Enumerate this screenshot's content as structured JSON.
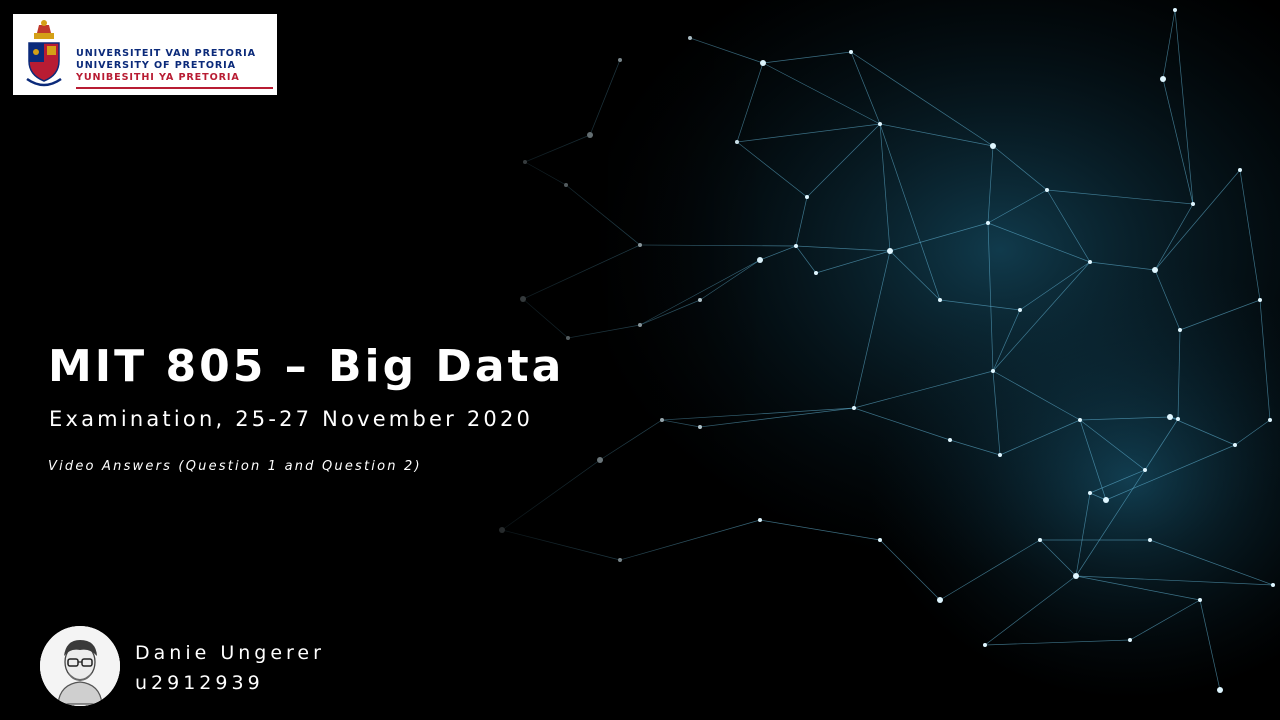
{
  "logo": {
    "lines": [
      "UNIVERSITEIT VAN PRETORIA",
      "UNIVERSITY OF PRETORIA",
      "YUNIBESITHI YA PRETORIA"
    ],
    "colors": {
      "primary": "#0b2a7a",
      "accent": "#b81c33"
    }
  },
  "slide": {
    "title": "MIT 805 – Big Data",
    "subtitle": "Examination, 25-27 November 2020",
    "note": "Video Answers (Question 1 and Question 2)"
  },
  "author": {
    "name": "Danie Ungerer",
    "student_number": "u2912939",
    "avatar_icon": "person-portrait-icon"
  },
  "background": {
    "style": "network-nodes",
    "color": "#4fb3d9"
  }
}
